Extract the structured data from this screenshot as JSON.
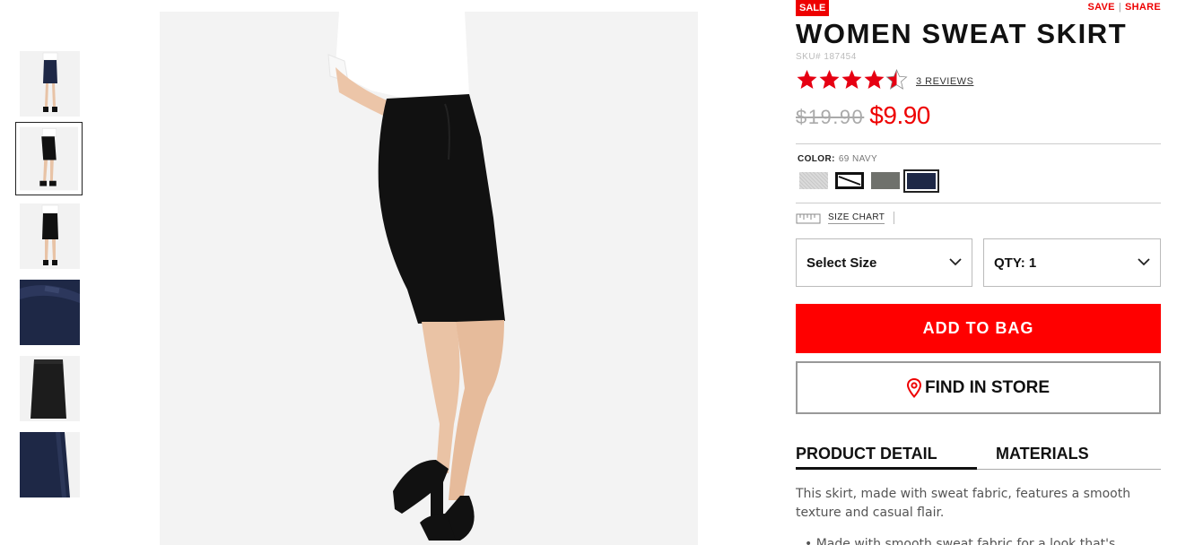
{
  "gallery": {
    "thumbnails": [
      {
        "name": "thumb-full-front",
        "selected": false
      },
      {
        "name": "thumb-side-model",
        "selected": true
      },
      {
        "name": "thumb-back-model",
        "selected": false
      },
      {
        "name": "thumb-waistband-detail",
        "selected": false
      },
      {
        "name": "thumb-flat-skirt",
        "selected": false
      },
      {
        "name": "thumb-hem-detail",
        "selected": false
      }
    ]
  },
  "product": {
    "badge": "SALE",
    "actions": {
      "save": "SAVE",
      "share": "SHARE"
    },
    "title": "WOMEN SWEAT SKIRT",
    "sku": "SKU# 187454",
    "rating": 4.5,
    "reviews_label": "3 REVIEWS",
    "old_price": "$19.90",
    "new_price": "$9.90",
    "color_label": "COLOR:",
    "color_value": "69 NAVY",
    "colors": [
      {
        "name": "gray-heather",
        "hex": "#cfcfcf",
        "selected": false
      },
      {
        "name": "black-stripe",
        "hex": "#1a1a1a",
        "selected": false
      },
      {
        "name": "olive-gray",
        "hex": "#6f716c",
        "selected": false
      },
      {
        "name": "navy",
        "hex": "#1e2846",
        "selected": true
      }
    ],
    "size_chart_label": "SIZE CHART",
    "size_select": "Select Size",
    "qty_select": "QTY: 1",
    "add_to_bag": "ADD TO BAG",
    "find_in_store": "FIND IN STORE",
    "tabs": [
      {
        "label": "PRODUCT DETAIL",
        "active": true
      },
      {
        "label": "MATERIALS",
        "active": false
      }
    ],
    "description": "This skirt, made with sweat fabric, features a smooth texture and casual flair.",
    "bullet_text": "•  Made with smooth sweat fabric for a look that's"
  },
  "colors": {
    "accent": "#ee0000",
    "star": "#e60012"
  }
}
